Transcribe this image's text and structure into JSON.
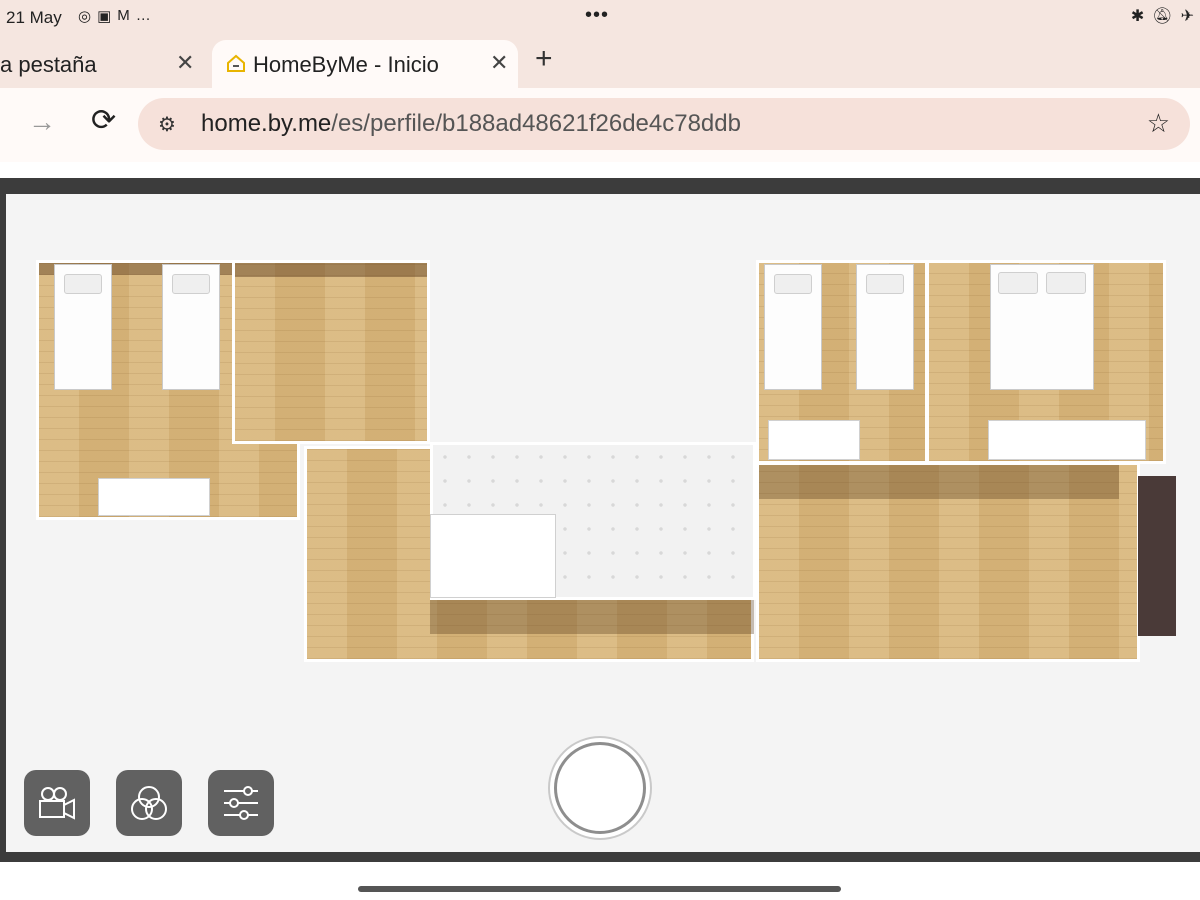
{
  "status_bar": {
    "time": "21 May",
    "center_dots": "•••",
    "left_icons": [
      "whatsapp-icon",
      "calendar-icon",
      "gmail-icon",
      "more-dots"
    ],
    "right_icons": [
      "bluetooth-icon",
      "bell-muted-icon",
      "airplane-icon"
    ]
  },
  "tabs": [
    {
      "title": "a pestaña",
      "close": "✕",
      "active": false
    },
    {
      "title": "HomeByMe - Inicio",
      "close": "✕",
      "active": true,
      "favicon": "homebyme-house-icon"
    }
  ],
  "new_tab": "+",
  "toolbar": {
    "forward": "→",
    "reload": "⟳",
    "site_info": "⚙",
    "url_host": "home.by.me",
    "url_path": "/es/perfile/b188ad48621f26de4c78ddb",
    "bookmark": "☆"
  },
  "viewer": {
    "controls": [
      "camera-icon",
      "filters-icon",
      "settings-sliders-icon"
    ],
    "shutter": "capture-button"
  },
  "colors": {
    "chrome_bg": "#f5e6e0",
    "omnibox_bg": "#f6e1da",
    "viewer_bg": "#f4f4f4",
    "control_bg": "#616161",
    "wood": "#d9b77c"
  }
}
